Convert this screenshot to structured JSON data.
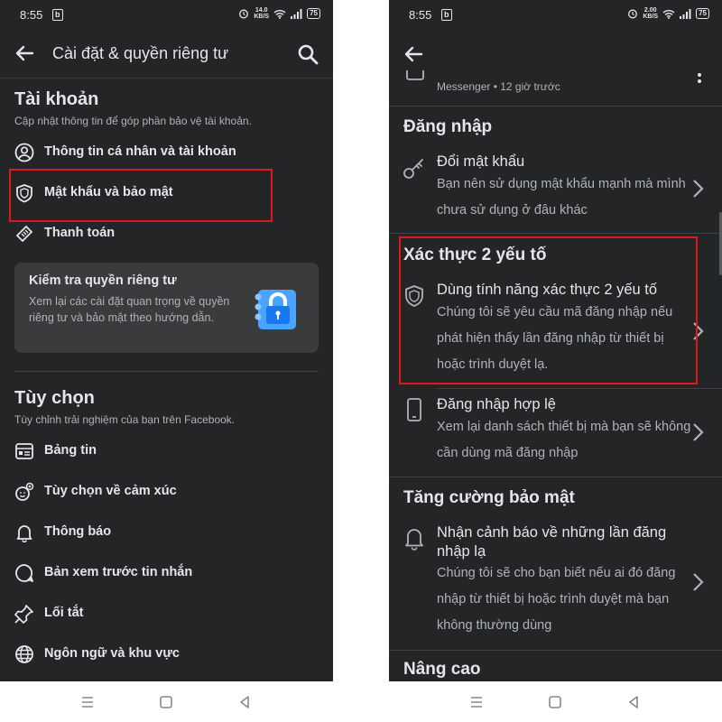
{
  "status_bar": {
    "time": "8:55",
    "notif_badge": "b",
    "left_speed": "14.0",
    "right_speed": "2.00",
    "speed_unit": "KB/S",
    "battery": "75"
  },
  "left": {
    "header": {
      "title": "Cài đặt & quyền riêng tư"
    },
    "account": {
      "title": "Tài khoản",
      "subtitle": "Cập nhật thông tin để góp phần bảo vệ tài khoản.",
      "items": [
        {
          "label": "Thông tin cá nhân và tài khoản",
          "icon": "person-circle-icon"
        },
        {
          "label": "Mật khẩu và bảo mật",
          "icon": "shield-icon"
        },
        {
          "label": "Thanh toán",
          "icon": "tag-icon"
        }
      ]
    },
    "privacy_card": {
      "title": "Kiểm tra quyền riêng tư",
      "description": "Xem lại các cài đặt quan trọng về quyền riêng tư và bảo mật theo hướng dẫn."
    },
    "preferences": {
      "title": "Tùy chọn",
      "subtitle": "Tùy chỉnh trải nghiệm của bạn trên Facebook.",
      "items": [
        {
          "label": "Bảng tin",
          "icon": "news-feed-icon"
        },
        {
          "label": "Tùy chọn về cảm xúc",
          "icon": "reactions-icon"
        },
        {
          "label": "Thông báo",
          "icon": "bell-icon"
        },
        {
          "label": "Bản xem trước tin nhắn",
          "icon": "message-preview-icon"
        },
        {
          "label": "Lối tắt",
          "icon": "pin-icon"
        },
        {
          "label": "Ngôn ngữ và khu vực",
          "icon": "globe-icon"
        }
      ]
    }
  },
  "right": {
    "messenger_meta": "Messenger • 12 giờ trước",
    "login": {
      "title": "Đăng nhập",
      "change_password": {
        "title": "Đổi mật khẩu",
        "description": "Bạn nên sử dụng mật khẩu mạnh mà mình chưa sử dụng ở đâu khác"
      }
    },
    "two_factor": {
      "title": "Xác thực 2 yếu tố",
      "item": {
        "title": "Dùng tính năng xác thực 2 yếu tố",
        "description": "Chúng tôi sẽ yêu cầu mã đăng nhập nếu phát hiện thấy lần đăng nhập từ thiết bị hoặc trình duyệt lạ."
      },
      "authorized_logins": {
        "title": "Đăng nhập hợp lệ",
        "description": "Xem lại danh sách thiết bị mà bạn sẽ không cần dùng mã đăng nhập"
      }
    },
    "extra_security": {
      "title": "Tăng cường bảo mật",
      "alerts": {
        "title": "Nhận cảnh báo về những lần đăng nhập lạ",
        "description": "Chúng tôi sẽ cho bạn biết nếu ai đó đăng nhập từ thiết bị hoặc trình duyệt mà bạn không thường dùng"
      }
    },
    "advanced": {
      "title": "Nâng cao"
    }
  },
  "colors": {
    "background": "#242526",
    "card": "#3a3b3c",
    "text_primary": "#e4e6eb",
    "text_secondary": "#b0b3b8",
    "highlight": "#e0181c",
    "lock_blue": "#1877f2"
  }
}
